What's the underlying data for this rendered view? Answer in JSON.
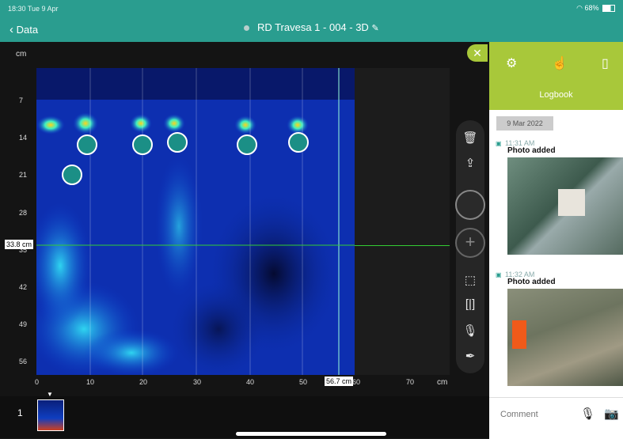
{
  "status": {
    "time": "18:30  Tue 9 Apr",
    "battery": "68%"
  },
  "nav": {
    "back_label": "Data",
    "title": "RD Travesa 1 - 004 - 3D"
  },
  "scan": {
    "unit": "cm",
    "y_ticks": [
      "7",
      "14",
      "21",
      "28",
      "35",
      "42",
      "49",
      "56"
    ],
    "x_ticks": [
      "0",
      "10",
      "20",
      "30",
      "40",
      "50",
      "60",
      "70"
    ],
    "x_unit": "cm",
    "depth_readout": "33.8 cm",
    "position_readout": "56.7 cm",
    "page_number": "1"
  },
  "logbook": {
    "title": "Logbook",
    "date": "9 Mar 2022",
    "entries": [
      {
        "time": "11:31 AM",
        "caption": "Photo added"
      },
      {
        "time": "11:32 AM",
        "caption": "Photo added"
      }
    ],
    "comment_placeholder": "Comment"
  },
  "colors": {
    "teal": "#2a9d8f",
    "lime": "#a8c83a"
  }
}
